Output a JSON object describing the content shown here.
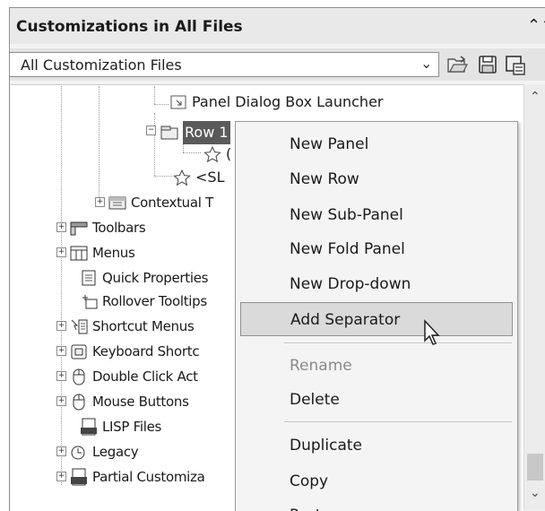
{
  "header": {
    "title": "Customizations in All Files",
    "collapse_icon": "double-chevron-up-icon"
  },
  "selector": {
    "value": "All Customization Files"
  },
  "toolbar": {
    "icons": [
      "open-file-icon",
      "save-icon",
      "load-partial-icon"
    ]
  },
  "tree": {
    "panel_dialog_box_launcher": "Panel Dialog Box Launcher",
    "row1": "Row 1",
    "row1_child_partial": "(",
    "slideout": "<SL",
    "contextual_tabs": "Contextual T",
    "toolbars": "Toolbars",
    "menus": "Menus",
    "quick_properties": "Quick Properties",
    "rollover_tooltips": "Rollover Tooltips",
    "shortcut_menus": "Shortcut Menus",
    "keyboard_shortcuts": "Keyboard Shortc",
    "double_click_actions": "Double Click Act",
    "mouse_buttons": "Mouse Buttons",
    "lisp_files": "LISP Files",
    "legacy": "Legacy",
    "partial_customizations": "Partial Customiza"
  },
  "context_menu": {
    "new_panel": "New Panel",
    "new_row": "New Row",
    "new_sub_panel": "New Sub-Panel",
    "new_fold_panel": "New Fold Panel",
    "new_drop_down": "New Drop-down",
    "add_separator": "Add Separator",
    "rename": "Rename",
    "delete": "Delete",
    "duplicate": "Duplicate",
    "copy": "Copy",
    "paste": "Paste"
  },
  "colors": {
    "selected_bg": "#5a5a5a",
    "hover_bg": "#dadada",
    "disabled_text": "#8a8a8a"
  }
}
